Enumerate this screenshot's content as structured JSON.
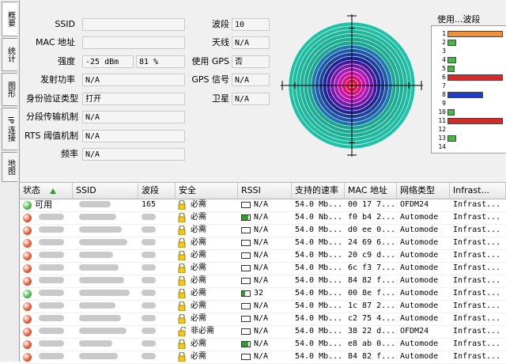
{
  "sidetabs": [
    "概要",
    "统计",
    "图形",
    "IP 连接",
    "地图"
  ],
  "fields": {
    "ssid": {
      "label": "SSID",
      "value": ""
    },
    "mac": {
      "label": "MAC 地址",
      "value": ""
    },
    "strength": {
      "label": "强度",
      "value": "-25 dBm",
      "value2": "81 %"
    },
    "tx_power": {
      "label": "发射功率",
      "value": "N/A"
    },
    "auth": {
      "label": "身份验证类型",
      "value": "打开"
    },
    "frag": {
      "label": "分段传输机制",
      "value": "N/A"
    },
    "rts": {
      "label": "RTS 阈值机制",
      "value": "N/A"
    },
    "freq": {
      "label": "频率",
      "value": "N/A"
    },
    "channel": {
      "label": "波段",
      "value": "10"
    },
    "antenna": {
      "label": "天线",
      "value": "N/A"
    },
    "gps_use": {
      "label": "使用 GPS",
      "value": "否"
    },
    "gps_signal": {
      "label": "GPS 信号",
      "value": "N/A"
    },
    "satellite": {
      "label": "卫星",
      "value": "N/A"
    }
  },
  "channel_panel": {
    "title": "使用...波段",
    "channels": [
      {
        "n": "1",
        "usage": 0.95,
        "color": "#f0913a"
      },
      {
        "n": "2",
        "usage": 0.12,
        "color": "#3cbf3c"
      },
      {
        "n": "3",
        "usage": 0,
        "color": "#3cbf3c"
      },
      {
        "n": "4",
        "usage": 0.12,
        "color": "#3cbf3c"
      },
      {
        "n": "5",
        "usage": 0.1,
        "color": "#3cbf3c"
      },
      {
        "n": "6",
        "usage": 0.95,
        "color": "#d42a2a"
      },
      {
        "n": "7",
        "usage": 0,
        "color": "#3cbf3c"
      },
      {
        "n": "8",
        "usage": 0.6,
        "color": "#1f3ec8"
      },
      {
        "n": "9",
        "usage": 0,
        "color": "#3cbf3c"
      },
      {
        "n": "10",
        "usage": 0.1,
        "color": "#3cbf3c"
      },
      {
        "n": "11",
        "usage": 0.95,
        "color": "#d42a2a"
      },
      {
        "n": "12",
        "usage": 0,
        "color": "#3cbf3c"
      },
      {
        "n": "13",
        "usage": 0.12,
        "color": "#3cbf3c"
      },
      {
        "n": "14",
        "usage": 0,
        "color": "#3cbf3c"
      }
    ]
  },
  "table": {
    "columns": [
      "状态",
      "SSID",
      "波段",
      "安全",
      "RSSI",
      "支持的速率",
      "MAC 地址",
      "网络类型",
      "Infrast..."
    ],
    "rows": [
      {
        "status": "green",
        "status_label": "可用",
        "ssid": "",
        "channel": "165",
        "lock": "closed",
        "security": "必需",
        "rssi_fill": 0,
        "rssi": "N/A",
        "rate": "54.0 Mb...",
        "mac": "00 17 7...",
        "nettype": "OFDM24",
        "infra": "Infrast..."
      },
      {
        "status": "red",
        "status_label": "",
        "ssid": "",
        "channel": "",
        "lock": "closed",
        "security": "必需",
        "rssi_fill": 0.8,
        "rssi": "N/A",
        "rate": "54.0 Nb...",
        "mac": "f0 b4 2...",
        "nettype": "Automode",
        "infra": "Infrast..."
      },
      {
        "status": "red",
        "status_label": "",
        "ssid": "",
        "channel": "",
        "lock": "closed",
        "security": "必需",
        "rssi_fill": 0,
        "rssi": "N/A",
        "rate": "54.0 Mb...",
        "mac": "d0 ee 0...",
        "nettype": "Automode",
        "infra": "Infrast..."
      },
      {
        "status": "red",
        "status_label": "",
        "ssid": "",
        "channel": "",
        "lock": "closed",
        "security": "必需",
        "rssi_fill": 0,
        "rssi": "N/A",
        "rate": "54.0 Mb...",
        "mac": "24 69 6...",
        "nettype": "Automode",
        "infra": "Infrast..."
      },
      {
        "status": "red",
        "status_label": "",
        "ssid": "",
        "channel": "",
        "lock": "closed",
        "security": "必需",
        "rssi_fill": 0,
        "rssi": "N/A",
        "rate": "54.0 Mb...",
        "mac": "20 c9 d...",
        "nettype": "Automode",
        "infra": "Infrast..."
      },
      {
        "status": "red",
        "status_label": "",
        "ssid": "",
        "channel": "",
        "lock": "closed",
        "security": "必需",
        "rssi_fill": 0,
        "rssi": "N/A",
        "rate": "54.0 Mb...",
        "mac": "6c f3 7...",
        "nettype": "Automode",
        "infra": "Infrast..."
      },
      {
        "status": "red",
        "status_label": "",
        "ssid": "",
        "channel": "",
        "lock": "closed",
        "security": "必需",
        "rssi_fill": 0,
        "rssi": "N/A",
        "rate": "54.0 Mb...",
        "mac": "84 82 f...",
        "nettype": "Automode",
        "infra": "Infrast..."
      },
      {
        "status": "green",
        "status_label": "",
        "ssid": "",
        "channel": "",
        "lock": "closed",
        "security": "必需",
        "rssi_fill": 0.35,
        "rssi": "32",
        "rate": "54.0 Mb...",
        "mac": "00 8e f...",
        "nettype": "Automode",
        "infra": "Infrast..."
      },
      {
        "status": "red",
        "status_label": "",
        "ssid": "",
        "channel": "",
        "lock": "closed",
        "security": "必需",
        "rssi_fill": 0,
        "rssi": "N/A",
        "rate": "54.0 Mb...",
        "mac": "1c 87 2...",
        "nettype": "Automode",
        "infra": "Infrast..."
      },
      {
        "status": "red",
        "status_label": "",
        "ssid": "",
        "channel": "",
        "lock": "closed",
        "security": "必需",
        "rssi_fill": 0,
        "rssi": "N/A",
        "rate": "54.0 Mb...",
        "mac": "c2 75 4...",
        "nettype": "Automode",
        "infra": "Infrast..."
      },
      {
        "status": "red",
        "status_label": "",
        "ssid": "",
        "channel": "",
        "lock": "open",
        "security": "非必需",
        "rssi_fill": 0,
        "rssi": "N/A",
        "rate": "54.0 Mb...",
        "mac": "38 22 d...",
        "nettype": "OFDM24",
        "infra": "Infrast..."
      },
      {
        "status": "red",
        "status_label": "",
        "ssid": "",
        "channel": "",
        "lock": "closed",
        "security": "必需",
        "rssi_fill": 0.8,
        "rssi": "N/A",
        "rate": "54.0 Mb...",
        "mac": "e8 ab 0...",
        "nettype": "Automode",
        "infra": "Infrast..."
      },
      {
        "status": "red",
        "status_label": "",
        "ssid": "",
        "channel": "",
        "lock": "closed",
        "security": "必需",
        "rssi_fill": 0,
        "rssi": "N/A",
        "rate": "54.0 Mb...",
        "mac": "84 82 f...",
        "nettype": "Automode",
        "infra": "Infrast..."
      }
    ]
  },
  "colors": {
    "green_status": "#3cb83c",
    "red_status": "#e0522a",
    "sort_arrow": "#2e9e2e"
  }
}
